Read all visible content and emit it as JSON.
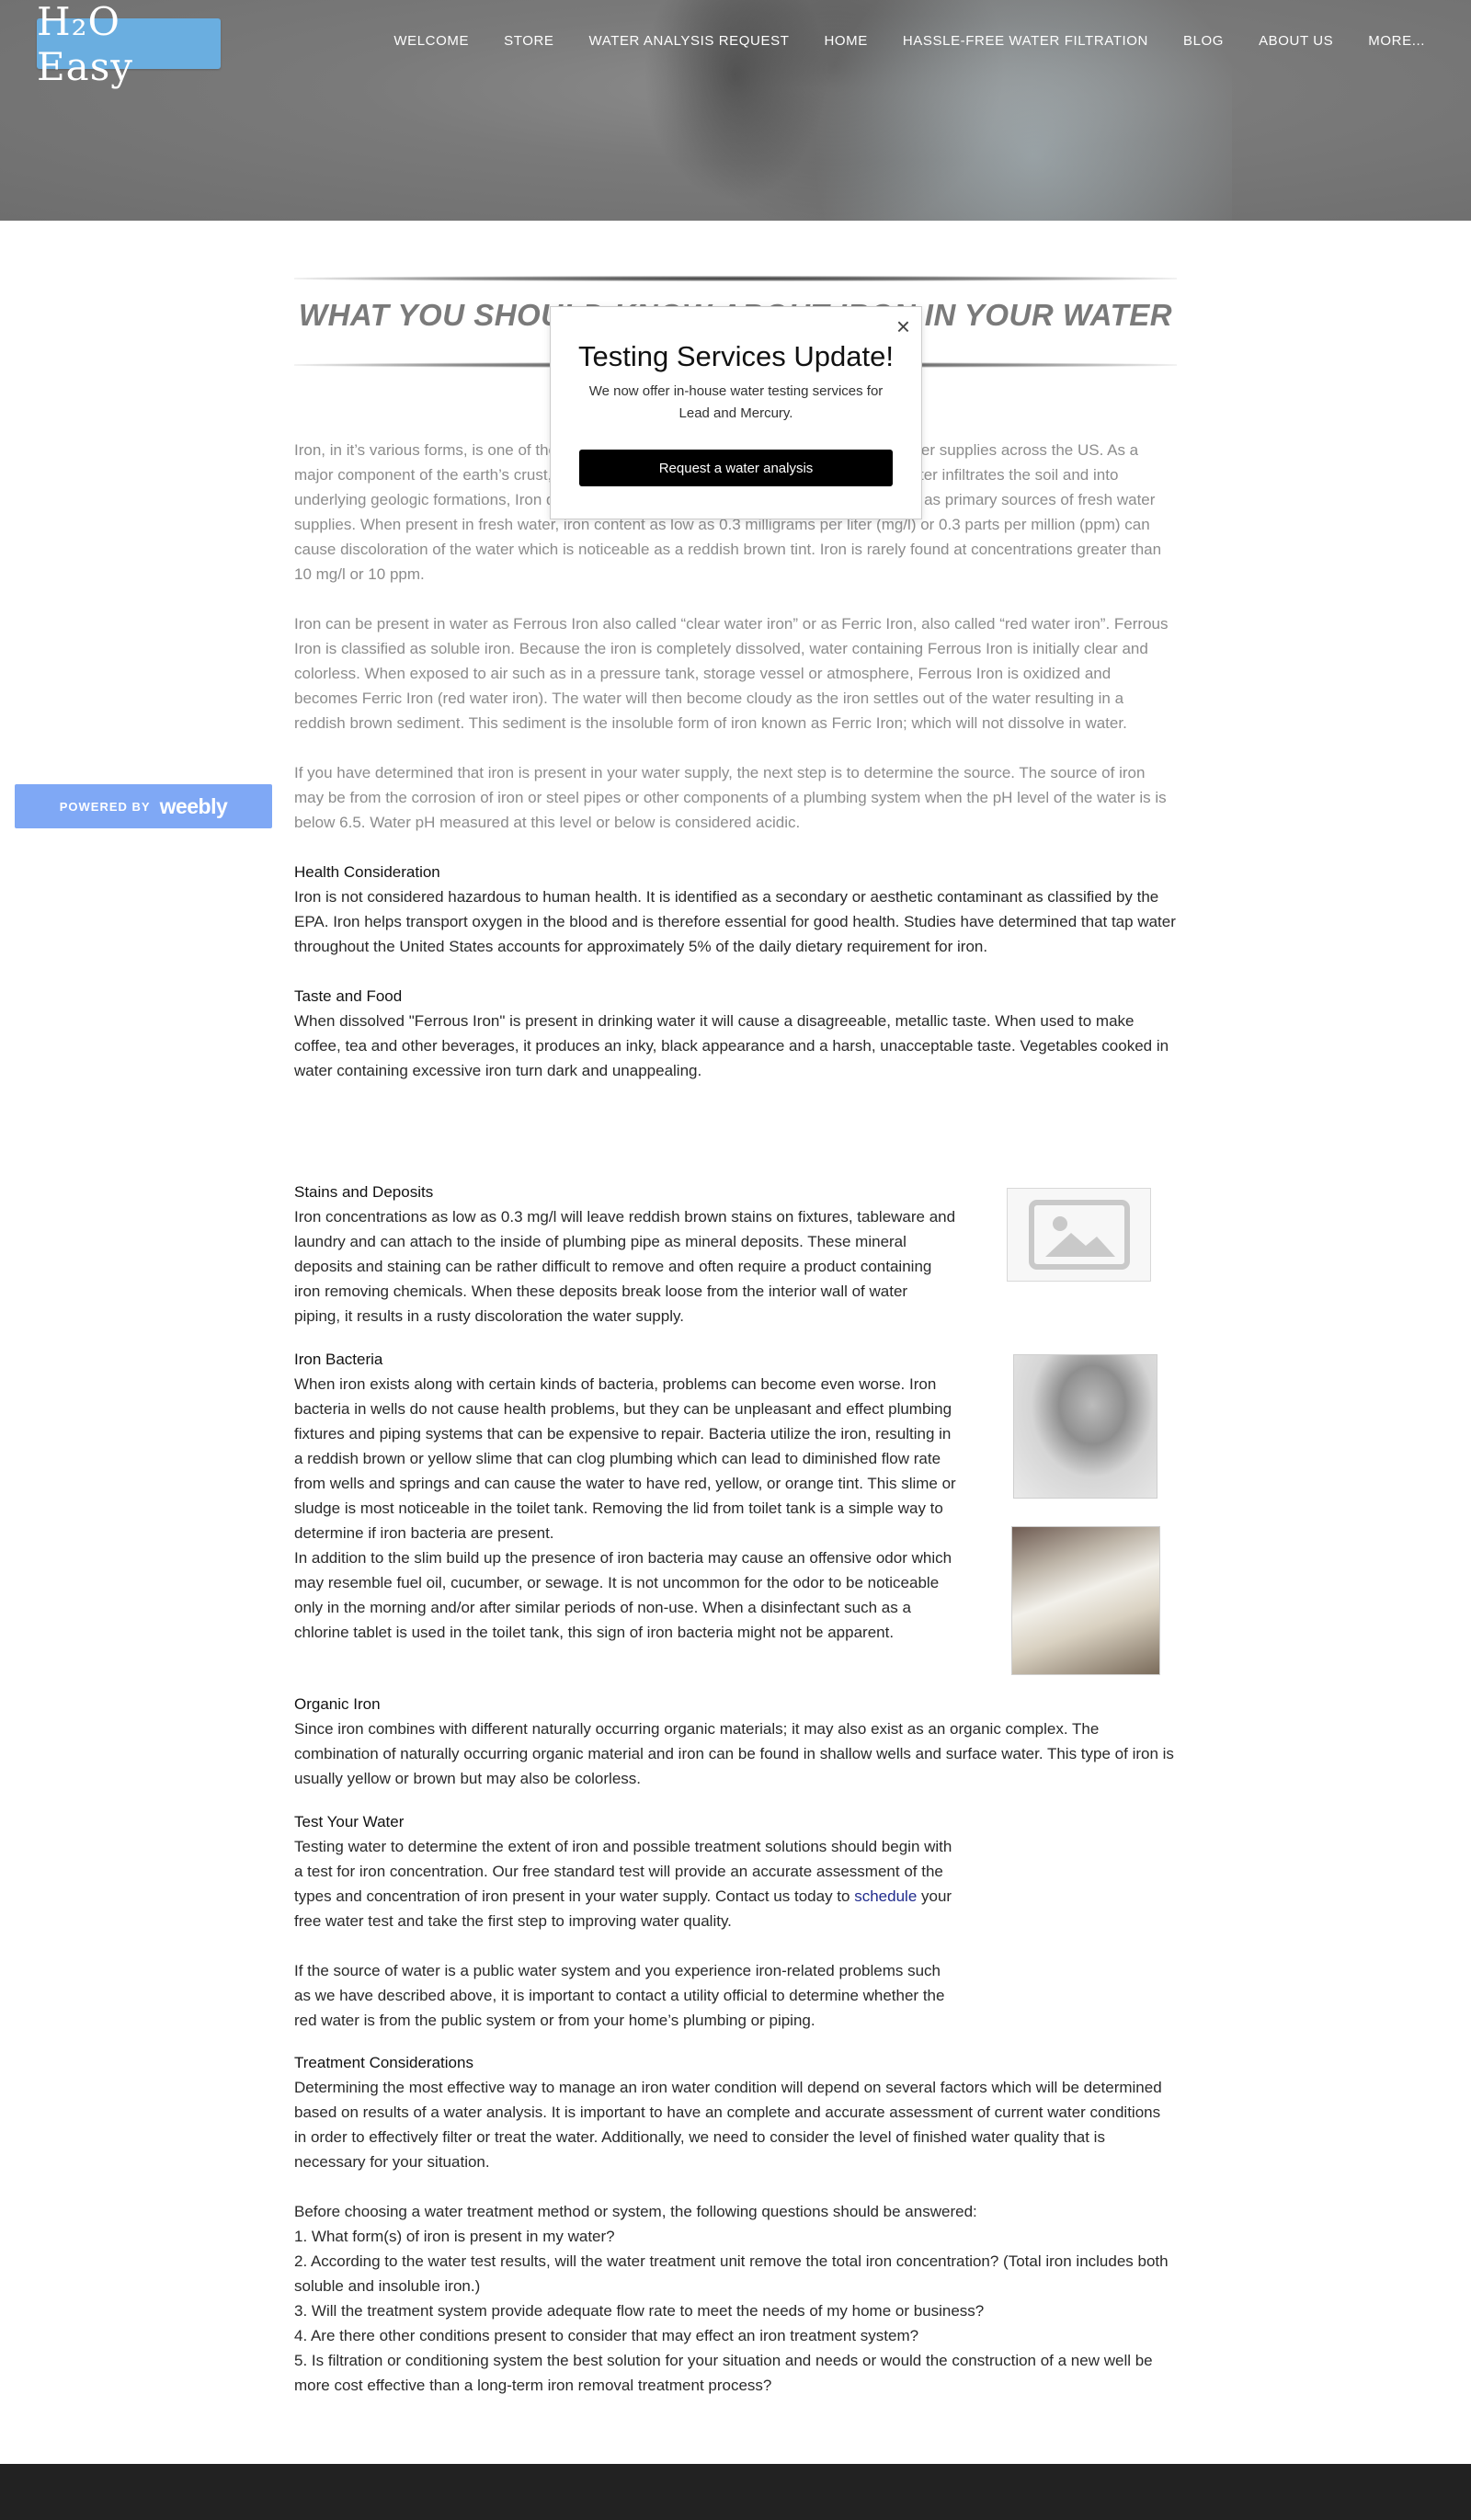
{
  "header": {
    "logo_text": "H₂O Easy",
    "nav": [
      {
        "label": "WELCOME"
      },
      {
        "label": "STORE"
      },
      {
        "label": "WATER ANALYSIS REQUEST"
      },
      {
        "label": "HOME"
      },
      {
        "label": "HASSLE-FREE WATER FILTRATION"
      },
      {
        "label": "BLOG"
      },
      {
        "label": "ABOUT US"
      },
      {
        "label": "MORE..."
      }
    ]
  },
  "page": {
    "title": "WHAT YOU SHOULD KNOW ABOUT IRON IN YOUR WATER",
    "intro": "Iron, in it’s various forms, is one of the most common contaminants found in residential water supplies across the US. As a major component of the earth’s crust, iron is found in virtually all soils and rocks. As rainwater infiltrates the soil and into underlying geologic formations, Iron dissolves into the water and enters aquifers that serve as primary sources of fresh water supplies. When present in fresh water, iron content as low as 0.3 milligrams per liter (mg/l) or 0.3 parts per million (ppm) can cause discoloration of the water which is noticeable as a reddish brown tint. Iron is rarely found at concentrations greater than 10 mg/l or 10 ppm.",
    "forms": "Iron can be present in water as Ferrous Iron also called “clear water iron” or as Ferric Iron, also called “red water iron”. Ferrous Iron is classified as soluble iron. Because the iron is completely dissolved, water containing Ferrous Iron is initially clear and colorless. When exposed to air such as in a pressure tank, storage vessel or atmosphere, Ferrous Iron is oxidized and becomes Ferric Iron (red water iron).  The water will then become cloudy as the iron settles out of the water resulting in a reddish brown sediment. This sediment is the insoluble form of iron known as Ferric Iron; which will not dissolve in water.",
    "source": "If you have determined that iron is present in your water supply, the next step is to determine the source. The source of iron may be from the corrosion of iron or steel pipes or other components of a plumbing system when the pH level of the water is is below 6.5. Water pH measured at this level or below is considered acidic.",
    "health_heading": "Health Consideration",
    "health_body": "Iron is not considered hazardous to human health. It is identified as a secondary or aesthetic contaminant as classified by the EPA. Iron helps transport oxygen in the blood and is therefore essential for good health. Studies have determined that tap water throughout the United States accounts for approximately 5% of the daily dietary requirement for iron.",
    "taste_heading": "Taste and Food",
    "taste_body": "When dissolved \"Ferrous Iron\" is present in drinking water it will cause a disagreeable, metallic taste. When used to make coffee, tea and other beverages, it produces an inky, black appearance and a harsh, unacceptable taste. Vegetables cooked in water containing excessive iron turn dark and unappealing.",
    "stains_heading": "Stains and Deposits",
    "stains_body": "Iron concentrations as low as 0.3 mg/l will leave reddish brown stains on fixtures, tableware and laundry and can attach to the inside of plumbing pipe as mineral deposits. These mineral deposits and staining can be rather difficult to remove and often require a product containing iron removing chemicals. When these deposits break loose from the interior wall of water piping, it results in a rusty discoloration the water supply.",
    "bacteria_heading": "Iron Bacteria",
    "bacteria_body1": "When iron exists along with certain kinds of bacteria, problems can become even worse. Iron bacteria in wells do not cause health problems, but they can be unpleasant and effect plumbing fixtures and piping systems that can be expensive to repair. Bacteria utilize the iron, resulting in a reddish brown or yellow slime that can clog plumbing which can lead to diminished flow rate from wells and springs and can cause the water to have red, yellow, or orange tint. This slime or sludge is most noticeable in the toilet tank. Removing the lid from toilet tank is a simple way to determine if iron bacteria are present.",
    "bacteria_body2": "In addition to the slim build up the presence of iron bacteria may cause an offensive odor which may resemble fuel oil, cucumber, or sewage. It is not uncommon for the odor to be noticeable only in the morning and/or after similar periods of non-use. When a disinfectant such as a chlorine tablet is used in the toilet tank, this sign of iron bacteria might not be apparent.",
    "organic_heading": "Organic Iron",
    "organic_body": "Since iron combines with different naturally occurring organic materials; it may also exist as an organic complex. The combination of naturally occurring organic material and iron can be found in shallow wells and surface water. This type of iron is usually yellow or brown but may also be colorless.",
    "test_heading": "Test Your Water",
    "test_body_before": "Testing water to determine the extent of iron and possible treatment solutions should begin with a test for iron concentration. Our free standard test will provide an accurate assessment of the types and concentration of iron present in your water supply. Contact us today to",
    "test_link": "schedule",
    "test_body_after": " your free water test and take the first step to improving water quality.",
    "public_body": "If the source of water is a public water system and you experience iron-related problems such as we have described above, it is important to contact a utility official to determine whether the red water is from the public system or from your home’s plumbing or piping.",
    "treatment_heading": "Treatment Considerations",
    "treatment_body": "Determining the most effective way to manage an iron water condition will depend on several factors which will be determined based on results of a water analysis. It is important to have an complete and accurate assessment of current water conditions in order to effectively filter or treat the water. Additionally, we need to consider the level of finished water quality that is necessary for your situation.",
    "questions_intro": "Before choosing a water treatment method or system, the following questions should be answered:",
    "questions": [
      "1. What form(s) of iron is present in my water?",
      "2. According to the water test results, will the water treatment unit remove the total iron concentration? (Total iron includes both soluble and insoluble iron.)",
      "3. Will the treatment system provide adequate flow rate to meet the needs of my home or business?",
      "4. Are there other conditions present to consider that may effect an iron treatment system?",
      "5. Is filtration or conditioning system the best solution for your situation and needs or would the construction of a new  well be more cost effective than a long-term iron removal treatment process?"
    ]
  },
  "popup": {
    "close_symbol": "×",
    "title": "Testing Services Update!",
    "body": "We now offer in-house water testing services for Lead and Mercury.",
    "button": "Request a water analysis"
  },
  "badge": {
    "powered_by": "POWERED BY",
    "brand": "weebly"
  }
}
